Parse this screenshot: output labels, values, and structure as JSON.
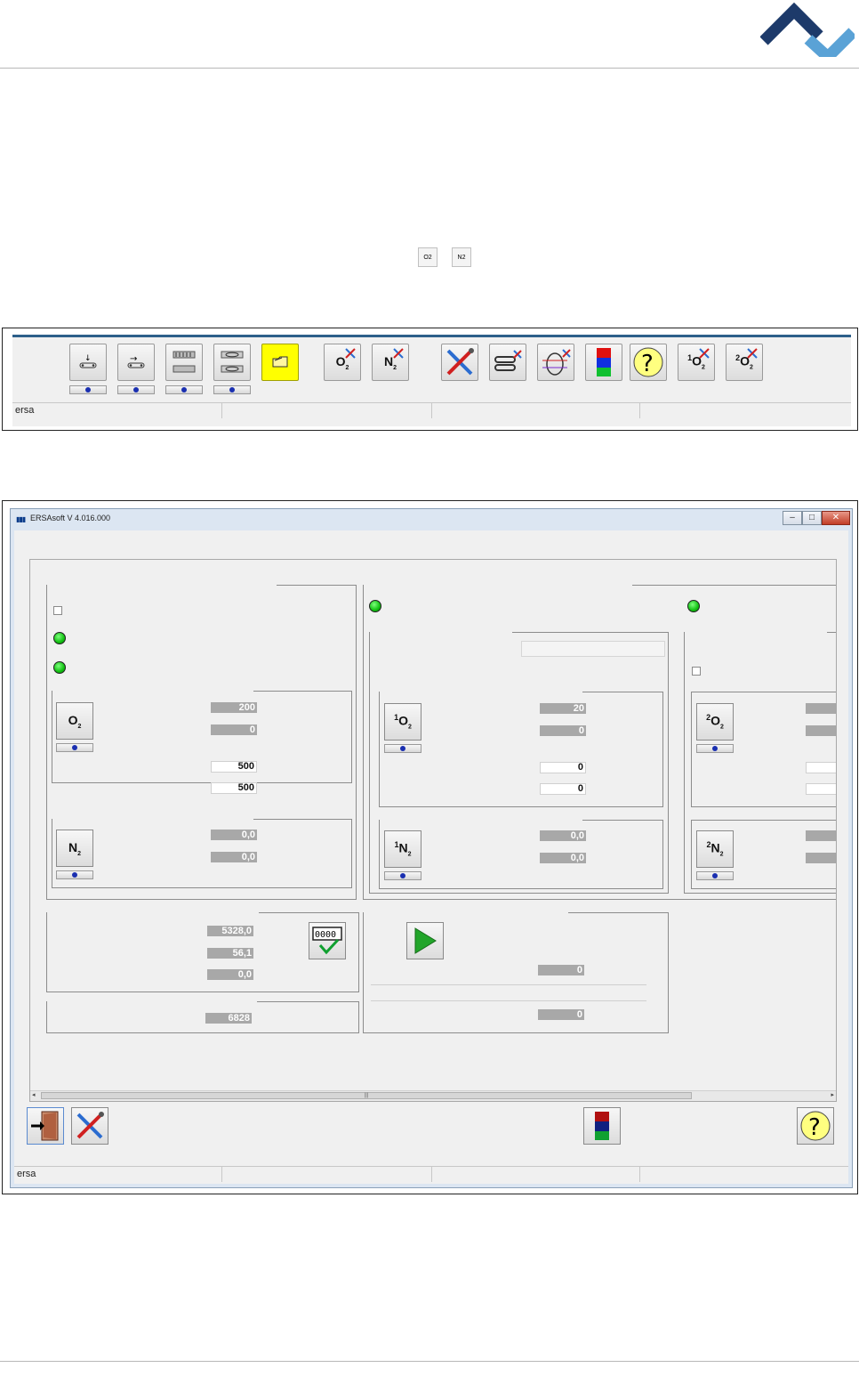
{
  "toolbar_figure": {
    "gas_mini_icons": [
      "O2",
      "N2"
    ],
    "buttons": [
      {
        "name": "conveyor-load",
        "glyph": "⇣"
      },
      {
        "name": "conveyor-transport",
        "glyph": "⇆"
      },
      {
        "name": "board-stack",
        "glyph": "≡"
      },
      {
        "name": "board-chain",
        "glyph": "⊂⊃"
      },
      {
        "name": "open-folder",
        "glyph": "⌂"
      },
      {
        "name": "o2-tool",
        "glyph": "O"
      },
      {
        "name": "n2-tool",
        "glyph": "N"
      }
    ],
    "status_text": "ersa"
  },
  "window": {
    "title": "ERSAsoft V 4.016.000",
    "controls": {
      "minimize": "–",
      "maximize": "□",
      "close": "✕"
    },
    "left_panel": {
      "o2": {
        "label": "O",
        "values_ro": [
          "200",
          "0"
        ],
        "values_rw": [
          "500",
          "500"
        ]
      },
      "n2": {
        "label": "N",
        "values_ro": [
          "0,0",
          "0,0"
        ]
      }
    },
    "zone1": {
      "o2": {
        "label": "O",
        "sup": "1",
        "values_ro": [
          "20",
          "0"
        ],
        "values_rw": [
          "0",
          "0"
        ]
      },
      "n2": {
        "label": "N",
        "sup": "1",
        "values_ro": [
          "0,0",
          "0,0"
        ]
      }
    },
    "zone2": {
      "o2": {
        "label": "O",
        "sup": "2"
      },
      "n2": {
        "label": "N",
        "sup": "2"
      }
    },
    "counters": {
      "values": [
        "5328,0",
        "56,1",
        "0,0"
      ],
      "total": "6828",
      "reset_icon": "0000"
    },
    "process": {
      "values": [
        "0",
        "0"
      ]
    },
    "status_text": "ersa"
  },
  "colors": {
    "accent": "#2d5f8a",
    "led": "#11c011",
    "help_bg": "#ffff80",
    "folder_bg": "#ffff00"
  }
}
